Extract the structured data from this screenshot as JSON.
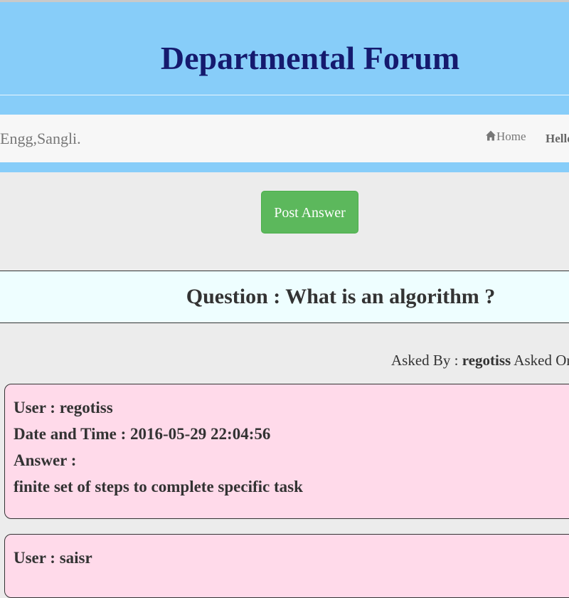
{
  "header": {
    "title": "Departmental Forum"
  },
  "navbar": {
    "brand": "Engg,Sangli.",
    "home_label": "Home",
    "greeting": "Hello"
  },
  "actions": {
    "post_answer_label": "Post Answer"
  },
  "question": {
    "text": "Question : What is an algorithm ?"
  },
  "meta": {
    "asked_by_label": "Asked By : ",
    "asked_by_user": "regotiss",
    "asked_on_label": " Asked On"
  },
  "answers": [
    {
      "user": "User : regotiss",
      "datetime": "Date and Time : 2016-05-29 22:04:56",
      "answer_label": "Answer :",
      "answer_text": "finite set of steps to complete specific task"
    },
    {
      "user": "User : saisr"
    }
  ],
  "colors": {
    "banner": "#87cdf9",
    "title": "#151a6e",
    "post_button": "#5cb85c",
    "question_bg": "#eefeff",
    "answer_bg": "#ffdaea"
  },
  "icons": {
    "home": "home-icon"
  }
}
